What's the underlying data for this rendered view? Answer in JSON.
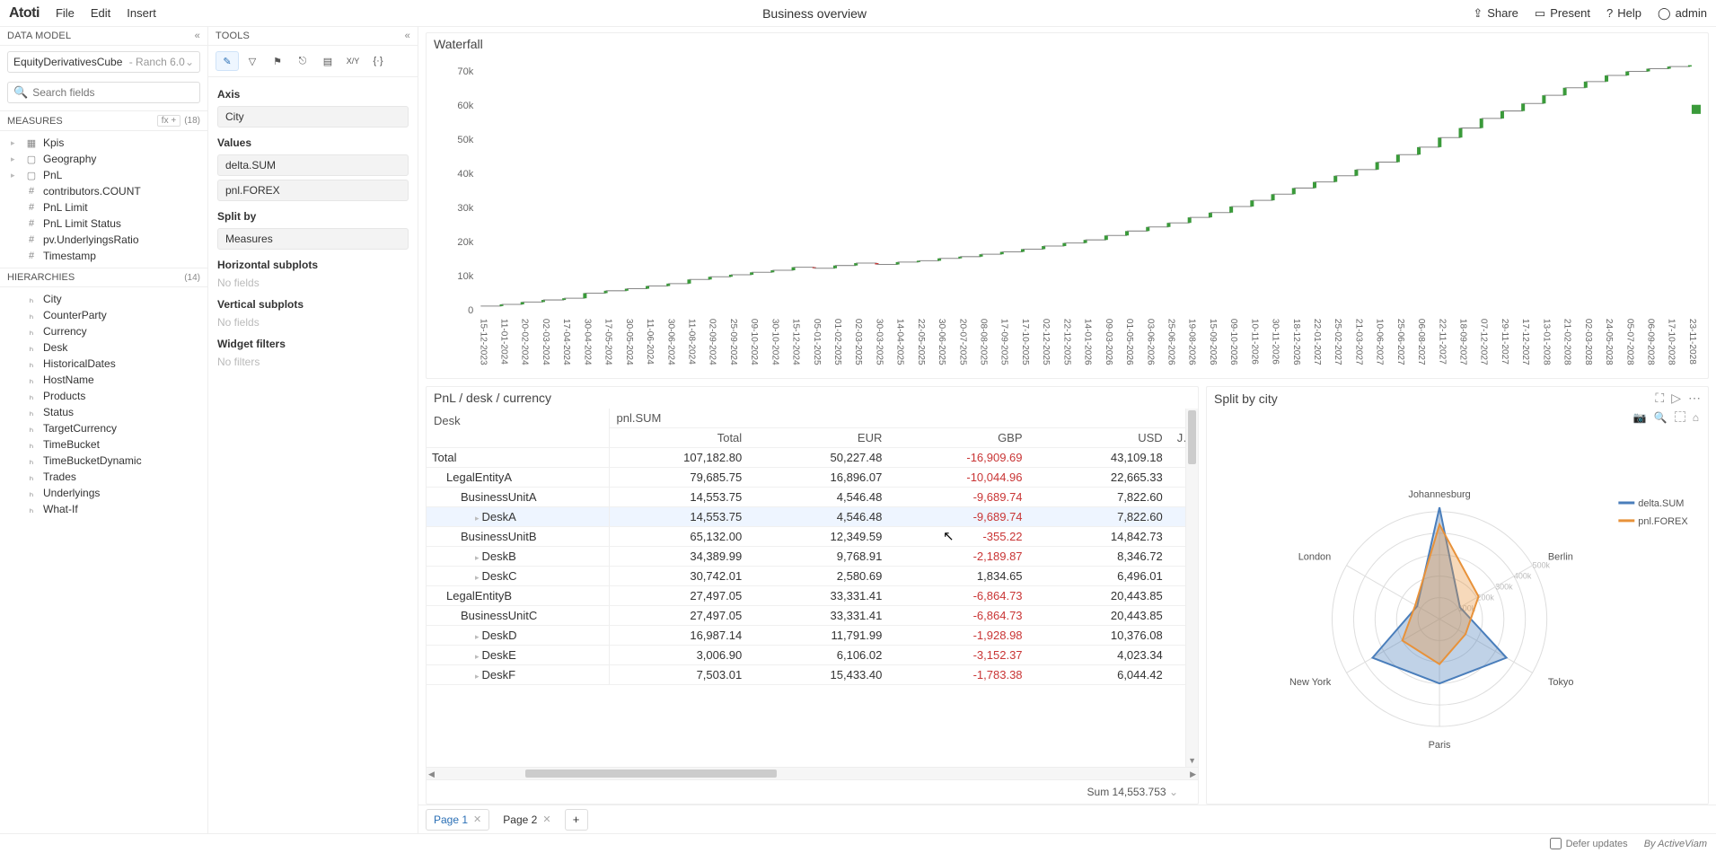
{
  "topbar": {
    "logo": "Atoti",
    "menu": [
      "File",
      "Edit",
      "Insert"
    ],
    "title": "Business overview",
    "right": {
      "share": "Share",
      "present": "Present",
      "help": "Help",
      "user": "admin"
    }
  },
  "datamodel": {
    "header": "DATA MODEL",
    "cube_name": "EquityDerivativesCube",
    "cube_branch": " - Ranch 6.0",
    "search_placeholder": "Search fields",
    "measures_header": "MEASURES",
    "measures_fx_btn": "fx  +",
    "measures_count": "(18)",
    "measures": [
      {
        "type": "folder",
        "expand": true,
        "glyph": "▦",
        "label": "Kpis"
      },
      {
        "type": "folder",
        "expand": true,
        "glyph": "▢",
        "label": "Geography"
      },
      {
        "type": "folder",
        "expand": false,
        "glyph": "▢",
        "label": "PnL"
      },
      {
        "type": "leaf",
        "glyph": "#",
        "label": "contributors.COUNT"
      },
      {
        "type": "leaf",
        "glyph": "#",
        "label": "PnL Limit"
      },
      {
        "type": "leaf",
        "glyph": "#",
        "label": "PnL Limit Status"
      },
      {
        "type": "leaf",
        "glyph": "#",
        "label": "pv.UnderlyingsRatio"
      },
      {
        "type": "leaf",
        "glyph": "#",
        "label": "Timestamp"
      }
    ],
    "hierarchies_header": "HIERARCHIES",
    "hierarchies_count": "(14)",
    "hierarchies": [
      "City",
      "CounterParty",
      "Currency",
      "Desk",
      "HistoricalDates",
      "HostName",
      "Products",
      "Status",
      "TargetCurrency",
      "TimeBucket",
      "TimeBucketDynamic",
      "Trades",
      "Underlyings",
      "What-If"
    ]
  },
  "tools": {
    "header": "TOOLS",
    "sections": {
      "axis_label": "Axis",
      "axis_chips": [
        "City"
      ],
      "values_label": "Values",
      "values_chips": [
        "delta.SUM",
        "pnl.FOREX"
      ],
      "splitby_label": "Split by",
      "splitby_chips": [
        "Measures"
      ],
      "hsub_label": "Horizontal subplots",
      "hsub_empty": "No fields",
      "vsub_label": "Vertical subplots",
      "vsub_empty": "No fields",
      "wfilters_label": "Widget filters",
      "wfilters_empty": "No filters"
    }
  },
  "waterfall": {
    "title": "Waterfall"
  },
  "chart_data": [
    {
      "type": "line",
      "title": "Waterfall",
      "ylabel": "",
      "ylim": [
        0,
        72000
      ],
      "yticks": [
        0,
        10000,
        20000,
        30000,
        40000,
        50000,
        60000,
        70000
      ],
      "ytick_labels": [
        "0",
        "10k",
        "20k",
        "30k",
        "40k",
        "50k",
        "60k",
        "70k"
      ],
      "categories": [
        "15-12-2023",
        "11-01-2024",
        "20-02-2024",
        "02-03-2024",
        "17-04-2024",
        "30-04-2024",
        "17-05-2024",
        "30-05-2024",
        "11-06-2024",
        "30-06-2024",
        "11-08-2024",
        "02-09-2024",
        "25-09-2024",
        "09-10-2024",
        "30-10-2024",
        "15-12-2024",
        "05-01-2025",
        "01-02-2025",
        "02-03-2025",
        "30-03-2025",
        "14-04-2025",
        "22-05-2025",
        "30-06-2025",
        "20-07-2025",
        "08-08-2025",
        "17-09-2025",
        "17-10-2025",
        "02-12-2025",
        "22-12-2025",
        "14-01-2026",
        "09-03-2026",
        "01-05-2026",
        "03-06-2026",
        "25-06-2026",
        "19-08-2026",
        "15-09-2026",
        "09-10-2026",
        "10-11-2026",
        "30-11-2026",
        "18-12-2026",
        "22-01-2027",
        "25-02-2027",
        "21-03-2027",
        "10-06-2027",
        "25-06-2027",
        "06-08-2027",
        "22-11-2027",
        "18-09-2027",
        "07-12-2027",
        "29-11-2027",
        "17-12-2027",
        "13-01-2028",
        "21-02-2028",
        "02-03-2028",
        "24-05-2028",
        "05-07-2028",
        "06-09-2028",
        "17-10-2028",
        "23-11-2028"
      ],
      "values": [
        1000,
        1500,
        2200,
        2800,
        3300,
        4800,
        5500,
        6100,
        6900,
        7600,
        8800,
        9600,
        10200,
        10900,
        11500,
        12400,
        12100,
        12900,
        13600,
        13200,
        13900,
        14300,
        15000,
        15500,
        16200,
        16900,
        17700,
        18600,
        19500,
        20400,
        21700,
        23000,
        24200,
        25400,
        27000,
        28400,
        30200,
        32000,
        33800,
        35600,
        37400,
        39200,
        41000,
        43200,
        45400,
        47600,
        50400,
        53200,
        56000,
        58200,
        60400,
        62800,
        65000,
        66800,
        68600,
        69800,
        70600,
        71200,
        71600
      ],
      "legend": [
        "delta.SUM"
      ]
    },
    {
      "type": "radar",
      "title": "Split by city",
      "categories": [
        "Johannesburg",
        "Berlin",
        "Tokyo",
        "Paris",
        "New York",
        "London"
      ],
      "radial_ticks": [
        100000,
        200000,
        300000,
        400000,
        500000
      ],
      "radial_tick_labels": [
        "100k",
        "200k",
        "300k",
        "400k",
        "500k"
      ],
      "series": [
        {
          "name": "delta.SUM",
          "color": "#4a7ebb",
          "values": [
            520000,
            110000,
            360000,
            300000,
            360000,
            120000
          ]
        },
        {
          "name": "pnl.FOREX",
          "color": "#e8923a",
          "values": [
            440000,
            210000,
            140000,
            210000,
            200000,
            130000
          ]
        }
      ]
    }
  ],
  "table": {
    "title": "PnL / desk / currency",
    "col0_header": "Desk",
    "measure_header": "pnl.SUM",
    "columns": [
      "Total",
      "EUR",
      "GBP",
      "USD",
      "JPY"
    ],
    "rows": [
      {
        "label": "Total",
        "indent": 0,
        "vals": [
          "107,182.80",
          "50,227.48",
          "-16,909.69",
          "43,109.18",
          ""
        ]
      },
      {
        "label": "LegalEntityA",
        "indent": 1,
        "vals": [
          "79,685.75",
          "16,896.07",
          "-10,044.96",
          "22,665.33",
          ""
        ]
      },
      {
        "label": "BusinessUnitA",
        "indent": 2,
        "vals": [
          "14,553.75",
          "4,546.48",
          "-9,689.74",
          "7,822.60",
          ""
        ]
      },
      {
        "label": "DeskA",
        "indent": 3,
        "sel": true,
        "exp": true,
        "vals": [
          "14,553.75",
          "4,546.48",
          "-9,689.74",
          "7,822.60",
          ""
        ]
      },
      {
        "label": "BusinessUnitB",
        "indent": 2,
        "vals": [
          "65,132.00",
          "12,349.59",
          "-355.22",
          "14,842.73",
          ""
        ]
      },
      {
        "label": "DeskB",
        "indent": 3,
        "exp": true,
        "vals": [
          "34,389.99",
          "9,768.91",
          "-2,189.87",
          "8,346.72",
          ""
        ]
      },
      {
        "label": "DeskC",
        "indent": 3,
        "exp": true,
        "vals": [
          "30,742.01",
          "2,580.69",
          "1,834.65",
          "6,496.01",
          ""
        ]
      },
      {
        "label": "LegalEntityB",
        "indent": 1,
        "vals": [
          "27,497.05",
          "33,331.41",
          "-6,864.73",
          "20,443.85",
          ""
        ]
      },
      {
        "label": "BusinessUnitC",
        "indent": 2,
        "vals": [
          "27,497.05",
          "33,331.41",
          "-6,864.73",
          "20,443.85",
          ""
        ]
      },
      {
        "label": "DeskD",
        "indent": 3,
        "exp": true,
        "vals": [
          "16,987.14",
          "11,791.99",
          "-1,928.98",
          "10,376.08",
          ""
        ]
      },
      {
        "label": "DeskE",
        "indent": 3,
        "exp": true,
        "vals": [
          "3,006.90",
          "6,106.02",
          "-3,152.37",
          "4,023.34",
          ""
        ]
      },
      {
        "label": "DeskF",
        "indent": 3,
        "exp": true,
        "vals": [
          "7,503.01",
          "15,433.40",
          "-1,783.38",
          "6,044.42",
          ""
        ]
      }
    ],
    "footer": "Sum 14,553.753"
  },
  "radar": {
    "title": "Split by city"
  },
  "tabs": [
    {
      "label": "Page 1",
      "active": true
    },
    {
      "label": "Page 2",
      "active": false
    }
  ],
  "statusbar": {
    "defer": "Defer updates",
    "byline": "By ActiveViam"
  }
}
